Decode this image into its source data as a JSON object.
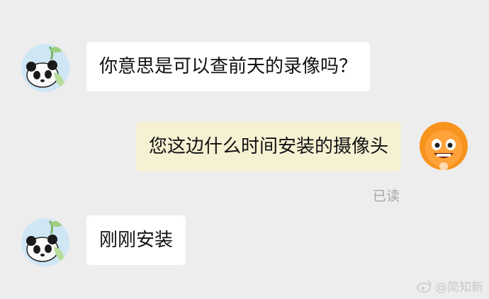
{
  "messages": [
    {
      "sender": "contact",
      "text": "你意思是可以查前天的录像吗？"
    },
    {
      "sender": "me",
      "text": "您这边什么时间安装的摄像头"
    },
    {
      "sender": "contact",
      "text": "刚刚安装"
    }
  ],
  "read_status": "已读",
  "watermark": "@简知新",
  "colors": {
    "background": "#ededed",
    "incoming_bubble": "#ffffff",
    "outgoing_bubble": "#f6f1d3",
    "read_text": "#a6a6a6"
  },
  "icons": {
    "contact_avatar": "panda-avatar-icon",
    "my_avatar": "orange-mascot-avatar-icon",
    "watermark": "weibo-logo-icon"
  }
}
